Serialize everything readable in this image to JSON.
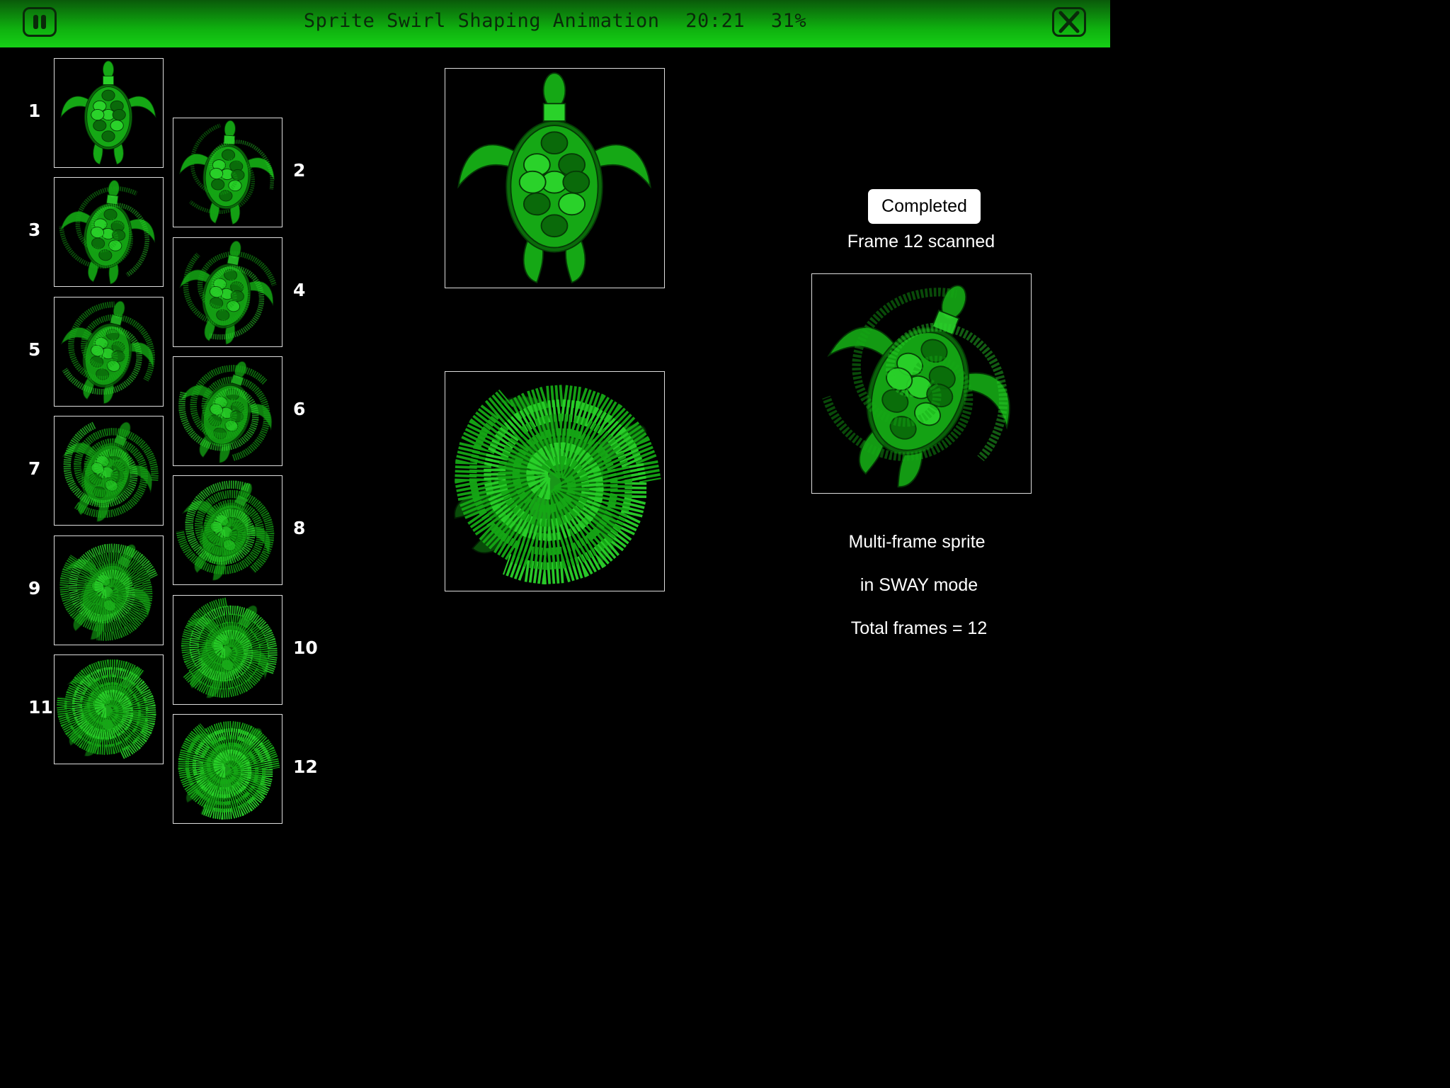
{
  "header": {
    "title": "Sprite Swirl Shaping Animation",
    "time": "20:21",
    "battery": "31%",
    "pause_icon": "pause-icon",
    "close_icon": "close-icon"
  },
  "frames": [
    {
      "label": "1",
      "swirl": 0.0
    },
    {
      "label": "2",
      "swirl": 0.09
    },
    {
      "label": "3",
      "swirl": 0.18
    },
    {
      "label": "4",
      "swirl": 0.27
    },
    {
      "label": "5",
      "swirl": 0.36
    },
    {
      "label": "6",
      "swirl": 0.45
    },
    {
      "label": "7",
      "swirl": 0.55
    },
    {
      "label": "8",
      "swirl": 0.64
    },
    {
      "label": "9",
      "swirl": 0.73
    },
    {
      "label": "10",
      "swirl": 0.82
    },
    {
      "label": "11",
      "swirl": 0.91
    },
    {
      "label": "12",
      "swirl": 1.0
    }
  ],
  "status": {
    "button_label": "Completed",
    "scan_text": "Frame 12 scanned"
  },
  "info": {
    "line1": "Multi-frame sprite",
    "line2": "in SWAY mode",
    "line3": "Total frames = 12"
  },
  "colors": {
    "header_green": "#0fb00f",
    "turtle_green": "#15a815",
    "turtle_light": "#2ad22a",
    "turtle_dark": "#0a6a0a"
  }
}
